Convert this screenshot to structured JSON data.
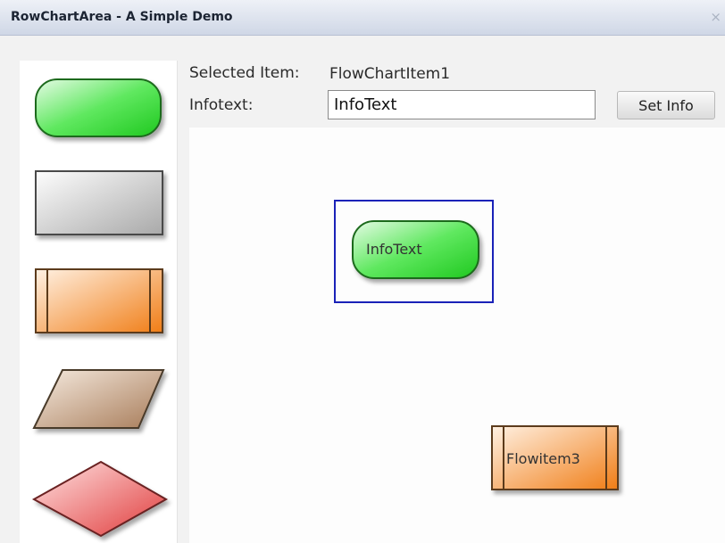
{
  "window": {
    "title": "RowChartArea - A Simple Demo",
    "close_symbol": "×"
  },
  "form": {
    "selected_label": "Selected Item:",
    "selected_value": "FlowChartItem1",
    "infotext_label": "Infotext:",
    "infotext_value": "InfoText",
    "set_button": "Set Info"
  },
  "palette": {
    "items": [
      {
        "shape": "rounded-rectangle",
        "color": "#3ddc3d"
      },
      {
        "shape": "rectangle",
        "color": "#c8c8c8"
      },
      {
        "shape": "rectangle-with-side-bars",
        "color": "#f28c28"
      },
      {
        "shape": "parallelogram",
        "color": "#b38b6d"
      },
      {
        "shape": "diamond",
        "color": "#e04848"
      }
    ]
  },
  "canvas": {
    "nodes": [
      {
        "id": "FlowChartItem1",
        "label": "InfoText",
        "shape": "rounded-rectangle",
        "selected": true
      },
      {
        "id": "Flowitem3",
        "label": "Flowitem3",
        "shape": "rectangle-with-side-bars",
        "selected": false
      }
    ],
    "selection_color": "#1a22b8"
  }
}
